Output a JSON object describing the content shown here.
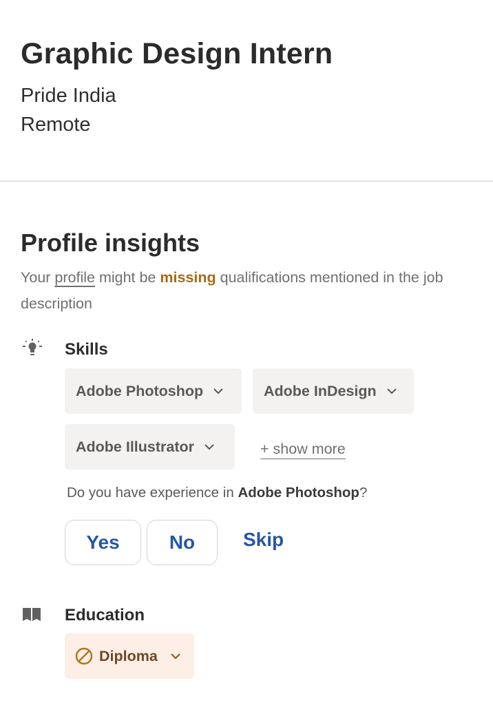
{
  "job": {
    "title": "Graphic Design Intern",
    "company": "Pride India",
    "location": "Remote"
  },
  "insights": {
    "title": "Profile insights",
    "desc_prefix": "Your ",
    "desc_link": "profile",
    "desc_mid": " might be ",
    "desc_highlight": "missing",
    "desc_suffix": " qualifications mentioned in the job description",
    "highlight_color": "#a86a10"
  },
  "skills": {
    "icon": "lightbulb-icon",
    "title": "Skills",
    "chips": [
      {
        "label": "Adobe Photoshop"
      },
      {
        "label": "Adobe InDesign"
      },
      {
        "label": "Adobe Illustrator"
      }
    ],
    "show_more": "+ show more",
    "question_prefix": "Do you have experience in ",
    "question_skill": "Adobe Photoshop",
    "question_suffix": "?",
    "buttons": {
      "yes": "Yes",
      "no": "No",
      "skip": "Skip"
    },
    "accent_color": "#2557a7"
  },
  "education": {
    "icon": "book-icon",
    "title": "Education",
    "chip": {
      "label": "Diploma",
      "status_icon": "ban-icon"
    }
  }
}
